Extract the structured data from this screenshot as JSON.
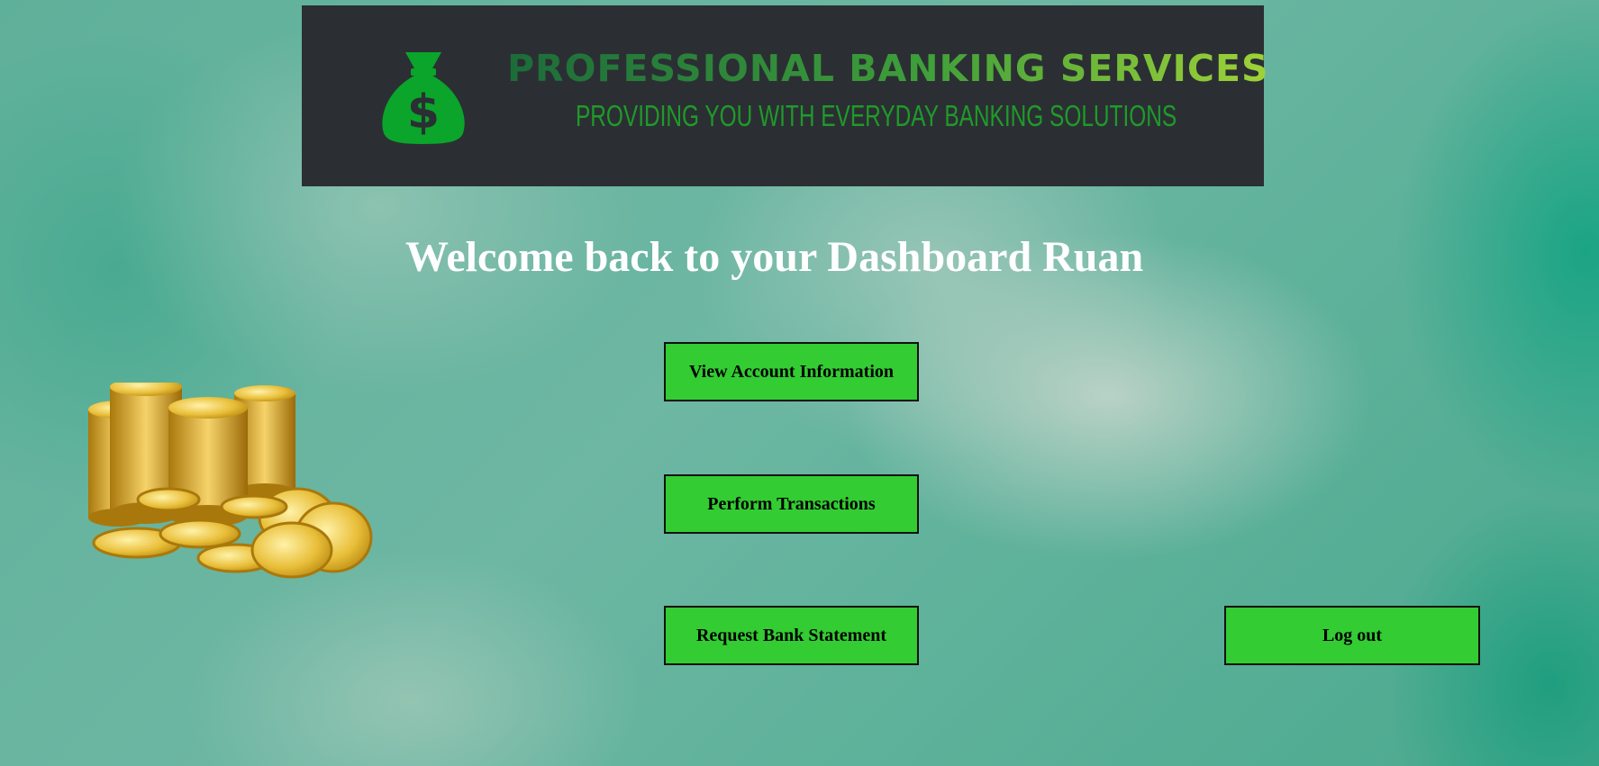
{
  "banner": {
    "title": "PROFESSIONAL BANKING SERVICES",
    "subtitle": "PROVIDING YOU WITH EVERYDAY BANKING SOLUTIONS",
    "icon": "money-bag-icon",
    "background_color": "#2b2f33",
    "icon_color": "#0aa52a"
  },
  "dashboard": {
    "welcome": "Welcome back to your Dashboard Ruan"
  },
  "actions": {
    "view_account_label": "View Account Information",
    "transactions_label": "Perform Transactions",
    "statement_label": "Request Bank Statement",
    "logout_label": "Log out",
    "button_color": "#33cc33"
  },
  "decorations": {
    "coins_image": "gold-coins-illustration"
  }
}
